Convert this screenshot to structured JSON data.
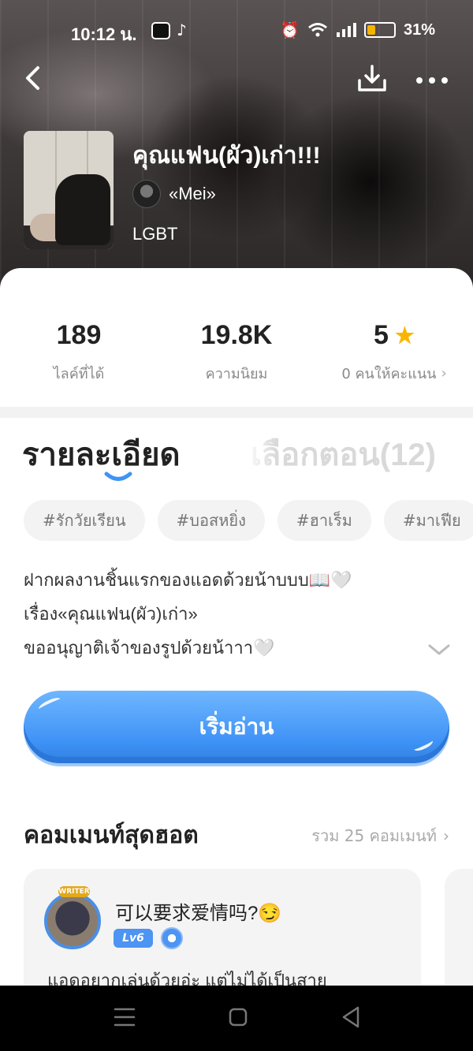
{
  "status_bar": {
    "time": "10:12 น.",
    "battery": "31%"
  },
  "header": {
    "back_icon": "chevron-left-icon",
    "download_icon": "download-icon",
    "more_icon": "more-horizontal-icon"
  },
  "book": {
    "title": "คุณแฟน(ผัว)เก่า!!!",
    "author": "«Mei»",
    "category": "LGBT"
  },
  "stats": {
    "likes_value": "189",
    "likes_label": "ไลค์ที่ได้",
    "popularity_value": "19.8K",
    "popularity_label": "ความนิยม",
    "rating_value": "5",
    "rating_label": "0 คนให้คะแนน"
  },
  "tabs": {
    "details": "รายละเอียด",
    "chapters": "เลือกตอน(12)"
  },
  "tags": [
    "#รักวัยเรียน",
    "#บอสหยิ่ง",
    "#ฮาเร็ม",
    "#มาเฟีย"
  ],
  "synopsis": {
    "line1": "ฝากผลงานชิ้นแรกของแอดด้วยน้าบบบ📖🤍",
    "line2": "เรื่อง«คุณแฟน(ผัว)เก่า»",
    "line3": "ขออนุญาติเจ้าของรูปด้วยน้าาา🤍"
  },
  "read_button": "เริ่มอ่าน",
  "comments": {
    "heading": "คอมเมนท์สุดฮอต",
    "total": "รวม 25 คอมเมนท์",
    "first": {
      "badge": "WRITER",
      "user": "可以要求爱情吗?😏",
      "level": "Lv6",
      "text": "แอดอยากเล่นด้วยอ่ะ แต่ไม่ได้เป็นสาย"
    }
  },
  "colors": {
    "accent": "#3f93f6",
    "star": "#f9b600",
    "muted": "#8a8a8a"
  }
}
